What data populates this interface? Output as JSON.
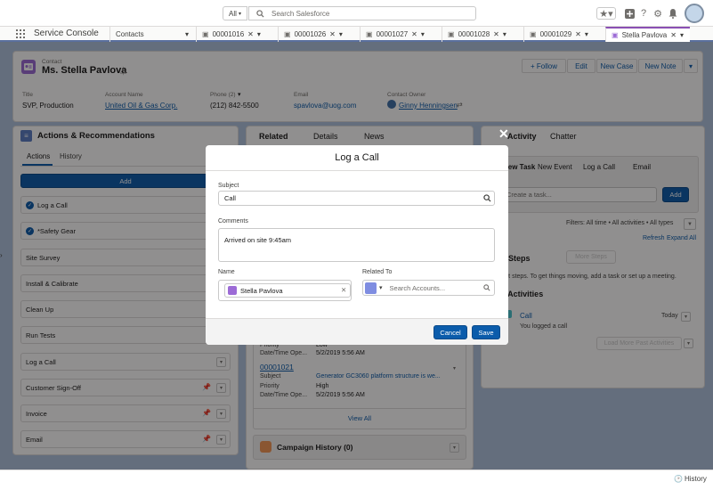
{
  "header": {
    "scope_label": "All",
    "search_placeholder": "Search Salesforce"
  },
  "nav": {
    "app_name": "Service Console",
    "object_tab": "Contacts",
    "tabs": [
      {
        "label": "00001016"
      },
      {
        "label": "00001026"
      },
      {
        "label": "00001027"
      },
      {
        "label": "00001028"
      },
      {
        "label": "00001029"
      },
      {
        "label": "Stella Pavlova"
      }
    ]
  },
  "record": {
    "object_type": "Contact",
    "name": "Ms. Stella Pavlova",
    "actions": [
      "+ Follow",
      "Edit",
      "New Case",
      "New Note"
    ],
    "fields": [
      {
        "label": "Title",
        "value": "SVP, Production"
      },
      {
        "label": "Account Name",
        "value": "United Oil & Gas Corp."
      },
      {
        "label": "Phone (2)",
        "value": "(212) 842-5500"
      },
      {
        "label": "Email",
        "value": "spavlova@uog.com"
      },
      {
        "label": "Contact Owner",
        "value": "Ginny Henningsen"
      }
    ]
  },
  "actions_panel": {
    "title": "Actions & Recommendations",
    "tabs": [
      "Actions",
      "History"
    ],
    "add_label": "Add",
    "items": [
      {
        "label": "Log a Call",
        "checked": true
      },
      {
        "label": "*Safety Gear",
        "checked": true
      },
      {
        "label": "Site Survey",
        "checked": false
      },
      {
        "label": "Install & Calibrate",
        "checked": false
      },
      {
        "label": "Clean Up",
        "checked": false
      },
      {
        "label": "Run Tests",
        "checked": false
      },
      {
        "label": "Log a Call",
        "checked": false
      },
      {
        "label": "Customer Sign-Off",
        "checked": false
      },
      {
        "label": "Invoice",
        "checked": false
      },
      {
        "label": "Email",
        "checked": false
      }
    ]
  },
  "related_panel": {
    "tabs": [
      "Related",
      "Details",
      "News"
    ],
    "case_partial": {
      "priority_label": "Priority",
      "priority_value": "Low",
      "date_label": "Date/Time Ope...",
      "date_value": "5/2/2019 5:56 AM"
    },
    "case": {
      "number": "00001021",
      "subject_label": "Subject",
      "subject_value": "Generator GC3060 platform structure is we...",
      "priority_label": "Priority",
      "priority_value": "High",
      "date_label": "Date/Time Ope...",
      "date_value": "5/2/2019 5:56 AM"
    },
    "view_all": "View All",
    "campaign_history": "Campaign History (0)"
  },
  "activity_panel": {
    "tabs": [
      "Activity",
      "Chatter"
    ],
    "subtabs": [
      "New Task",
      "New Event",
      "Log a Call",
      "Email"
    ],
    "task_placeholder": "Create a task...",
    "add_label": "Add",
    "filters": "Filters: All time • All activities • All types",
    "refresh": "Refresh",
    "expand_all": "Expand All",
    "more_steps": "More Steps",
    "next_steps_title": "Next Steps",
    "no_steps": "No next steps. To get things moving, add a task or set up a meeting.",
    "past_title": "Past Activities",
    "item_title": "Call",
    "item_date": "Today",
    "item_desc": "You logged a call",
    "load_more": "Load More Past Activities"
  },
  "modal": {
    "title": "Log a Call",
    "subject_label": "Subject",
    "subject_value": "Call",
    "comments_label": "Comments",
    "comments_value": "Arrived on site 9:45am",
    "name_label": "Name",
    "name_value": "Stella Pavlova",
    "related_label": "Related To",
    "related_placeholder": "Search Accounts...",
    "cancel": "Cancel",
    "save": "Save"
  },
  "footer": {
    "history": "History"
  },
  "colors": {
    "brand": "#0b5cab",
    "overlay": "#080707",
    "contact_icon": "#9c6bd6",
    "campaign_icon": "#f49756",
    "check_green": "#4bca81"
  }
}
